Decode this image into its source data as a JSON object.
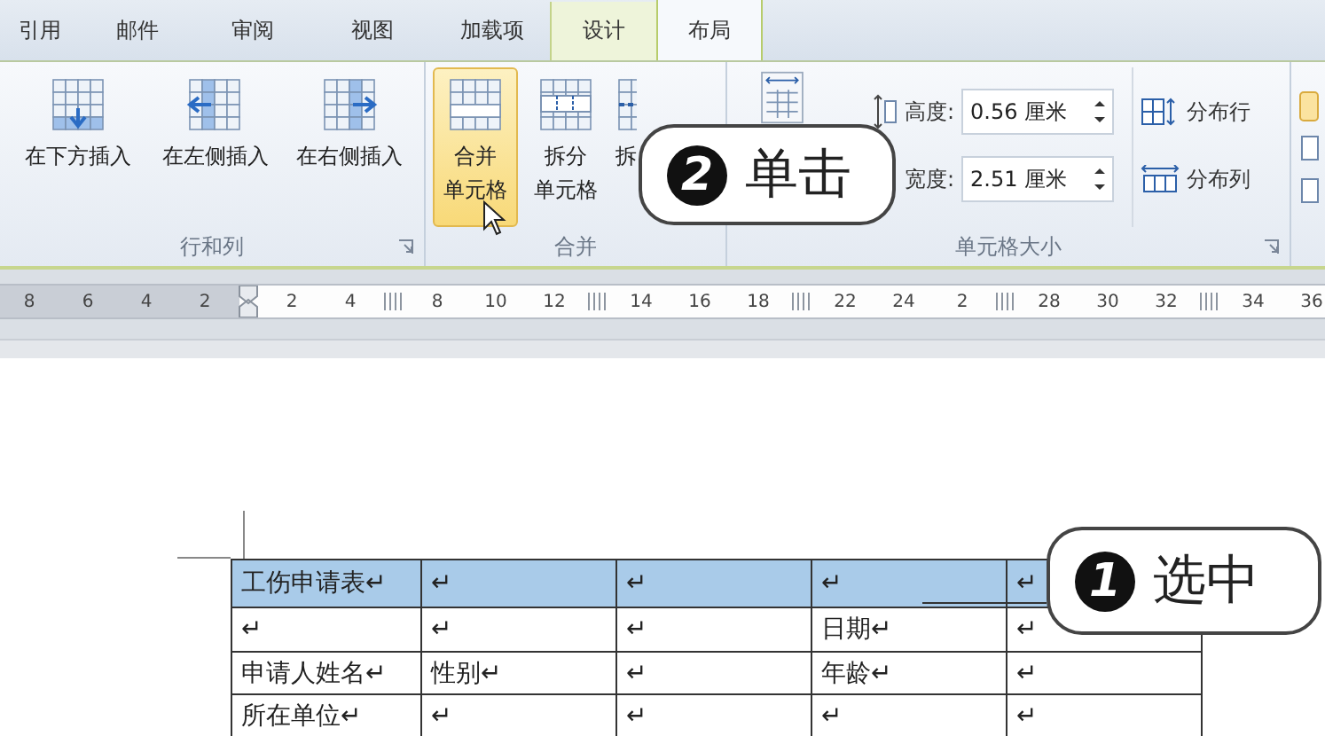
{
  "tabs": [
    {
      "label": "引用",
      "selected": false,
      "kind": "normal"
    },
    {
      "label": "邮件",
      "selected": false,
      "kind": "normal"
    },
    {
      "label": "审阅",
      "selected": false,
      "kind": "normal"
    },
    {
      "label": "视图",
      "selected": false,
      "kind": "normal"
    },
    {
      "label": "加载项",
      "selected": false,
      "kind": "normal"
    },
    {
      "label": "设计",
      "selected": false,
      "kind": "contextual"
    },
    {
      "label": "布局",
      "selected": true,
      "kind": "contextual"
    }
  ],
  "ribbon": {
    "groups": [
      {
        "kind": "buttons",
        "title": "行和列",
        "launcher": true,
        "buttons": [
          {
            "lines": [
              "在下方插入"
            ],
            "highlighted": false
          },
          {
            "lines": [
              "在左侧插入"
            ],
            "highlighted": false
          },
          {
            "lines": [
              "在右侧插入"
            ],
            "highlighted": false
          }
        ]
      },
      {
        "kind": "buttons",
        "title": "合并",
        "launcher": false,
        "buttons": [
          {
            "lines": [
              "合并",
              "单元格"
            ],
            "highlighted": true
          },
          {
            "lines": [
              "拆分",
              "单元格"
            ],
            "highlighted": false
          },
          {
            "lines": [
              "拆"
            ],
            "highlighted": false
          }
        ]
      },
      {
        "kind": "size",
        "title": "单元格大小",
        "launcher": true,
        "fields": [
          {
            "label": "高度:",
            "value": "0.56 厘米"
          },
          {
            "label": "宽度:",
            "value": "2.51 厘米"
          }
        ],
        "buttons": [
          {
            "label": "分布行"
          },
          {
            "label": "分布列"
          }
        ]
      }
    ]
  },
  "ruler": [
    {
      "kind": "number",
      "label": "8"
    },
    {
      "kind": "number",
      "label": "6"
    },
    {
      "kind": "number",
      "label": "4"
    },
    {
      "kind": "number",
      "label": "2"
    },
    {
      "kind": "indent"
    },
    {
      "kind": "number",
      "label": "2"
    },
    {
      "kind": "number",
      "label": "4"
    },
    {
      "kind": "marker"
    },
    {
      "kind": "number",
      "label": "8"
    },
    {
      "kind": "number",
      "label": "10"
    },
    {
      "kind": "number",
      "label": "12"
    },
    {
      "kind": "marker"
    },
    {
      "kind": "number",
      "label": "14"
    },
    {
      "kind": "number",
      "label": "16"
    },
    {
      "kind": "number",
      "label": "18"
    },
    {
      "kind": "marker"
    },
    {
      "kind": "number",
      "label": "22"
    },
    {
      "kind": "number",
      "label": "24"
    },
    {
      "kind": "number",
      "label": "2"
    },
    {
      "kind": "marker"
    },
    {
      "kind": "number",
      "label": "28"
    },
    {
      "kind": "number",
      "label": "30"
    },
    {
      "kind": "number",
      "label": "32"
    },
    {
      "kind": "marker"
    },
    {
      "kind": "number",
      "label": "34"
    },
    {
      "kind": "number",
      "label": "36"
    }
  ],
  "table": {
    "rows": [
      {
        "selected": true,
        "cells": [
          "工伤申请表↵",
          "↵",
          "↵",
          "↵",
          "↵"
        ]
      },
      {
        "selected": false,
        "cells": [
          "↵",
          "↵",
          "↵",
          "日期↵",
          "↵"
        ]
      },
      {
        "selected": false,
        "cells": [
          "申请人姓名↵",
          "性别↵",
          "↵",
          "年龄↵",
          "↵"
        ]
      },
      {
        "selected": false,
        "cells": [
          "所在单位↵",
          "↵",
          "↵",
          "↵",
          "↵"
        ]
      }
    ]
  },
  "callouts": [
    {
      "number": "2",
      "text": "单击"
    },
    {
      "number": "1",
      "text": "选中"
    }
  ]
}
